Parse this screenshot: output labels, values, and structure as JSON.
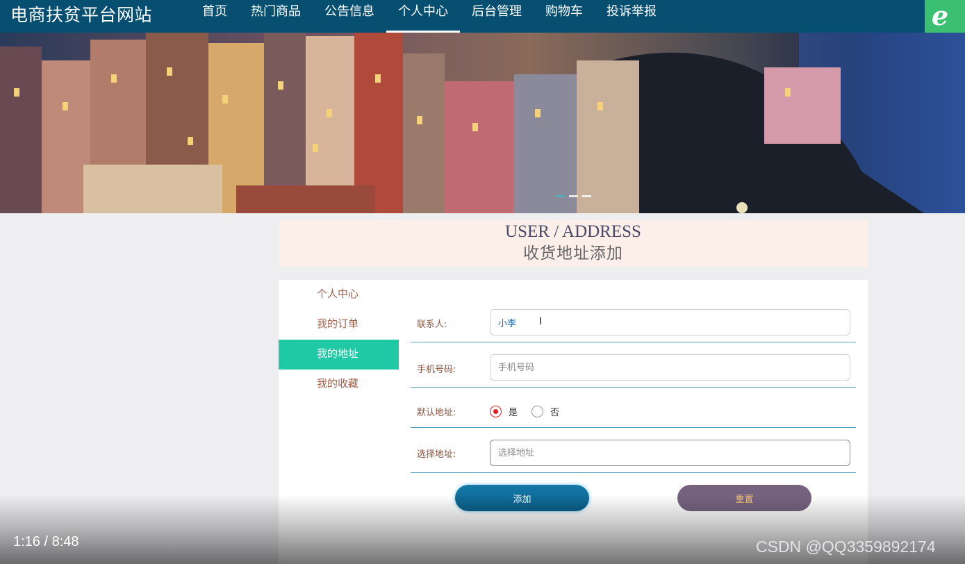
{
  "site": {
    "title": "电商扶贫平台网站"
  },
  "nav": {
    "items": [
      {
        "label": "首页"
      },
      {
        "label": "热门商品"
      },
      {
        "label": "公告信息"
      },
      {
        "label": "个人中心"
      },
      {
        "label": "后台管理"
      },
      {
        "label": "购物车"
      },
      {
        "label": "投诉举报"
      }
    ],
    "active_index": 3
  },
  "section": {
    "title_en": "USER / ADDRESS",
    "title_cn": "收货地址添加"
  },
  "sidebar": {
    "items": [
      {
        "label": "个人中心"
      },
      {
        "label": "我的订单"
      },
      {
        "label": "我的地址"
      },
      {
        "label": "我的收藏"
      }
    ],
    "active_index": 2
  },
  "form": {
    "contact": {
      "label": "联系人:",
      "value": "小李"
    },
    "phone": {
      "label": "手机号码:",
      "placeholder": "手机号码"
    },
    "default": {
      "label": "默认地址:",
      "options": [
        "是",
        "否"
      ],
      "selected": "是"
    },
    "address": {
      "label": "选择地址:",
      "placeholder": "选择地址"
    },
    "add_label": "添加",
    "reset_label": "重置"
  },
  "video": {
    "time": "1:16 / 8:48"
  },
  "watermark": "CSDN @QQ3359892174",
  "colors": {
    "nav_bg": "#064f70",
    "sidebar_active": "#20c9a5",
    "add_button": "#0b6f9c",
    "reset_button": "#75627f"
  }
}
